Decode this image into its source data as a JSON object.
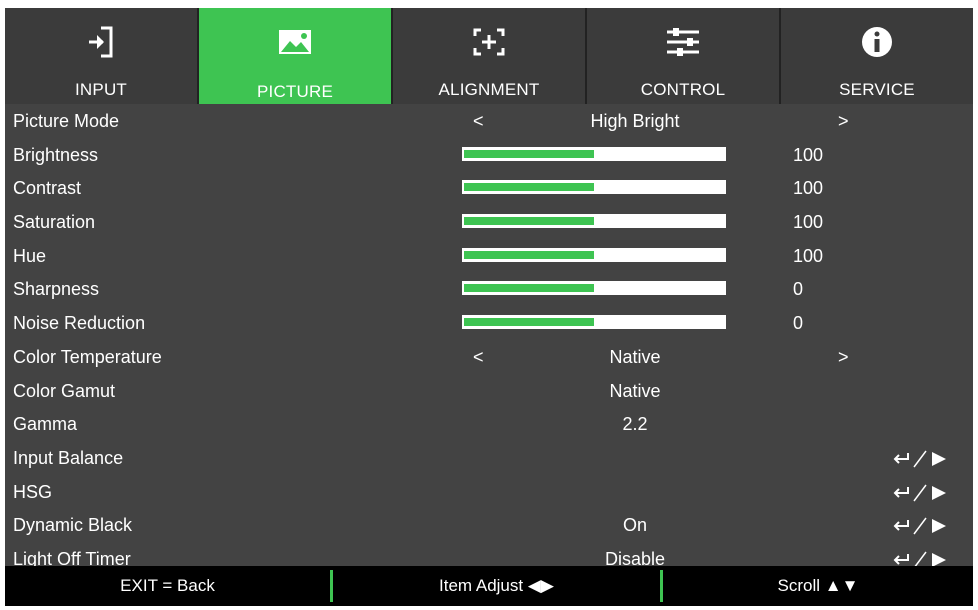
{
  "tabs": [
    {
      "label": "INPUT",
      "icon": "input-icon"
    },
    {
      "label": "PICTURE",
      "icon": "picture-icon",
      "active": true
    },
    {
      "label": "ALIGNMENT",
      "icon": "alignment-icon"
    },
    {
      "label": "CONTROL",
      "icon": "control-icon"
    },
    {
      "label": "SERVICE",
      "icon": "service-icon"
    }
  ],
  "menu": {
    "picture_mode": {
      "label": "Picture Mode",
      "left": "<",
      "value": "High Bright",
      "right": ">"
    },
    "brightness": {
      "label": "Brightness",
      "value": "100",
      "level": 0.5
    },
    "contrast": {
      "label": "Contrast",
      "value": "100",
      "level": 0.5
    },
    "saturation": {
      "label": "Saturation",
      "value": "100",
      "level": 0.5
    },
    "hue": {
      "label": "Hue",
      "value": "100",
      "level": 0.5
    },
    "sharpness": {
      "label": "Sharpness",
      "value": "0",
      "level": 0.5
    },
    "noise_reduction": {
      "label": "Noise Reduction",
      "value": "0",
      "level": 0.5
    },
    "color_temperature": {
      "label": "Color Temperature",
      "left": "<",
      "value": "Native",
      "right": ">"
    },
    "color_gamut": {
      "label": "Color Gamut",
      "value": "Native"
    },
    "gamma": {
      "label": "Gamma",
      "value": "2.2"
    },
    "input_balance": {
      "label": "Input Balance"
    },
    "hsg": {
      "label": "HSG"
    },
    "dynamic_black": {
      "label": "Dynamic Black",
      "value": "On"
    },
    "light_off_timer": {
      "label": "Light Off Timer",
      "value": "Disable"
    }
  },
  "footer": {
    "exit": "EXIT = Back",
    "item_adjust": "Item Adjust ◀▶",
    "scroll": "Scroll ▲▼"
  },
  "colors": {
    "accent": "#3ec452",
    "panel": "#434343",
    "tab": "#3b3b3b",
    "footer": "#000000"
  }
}
